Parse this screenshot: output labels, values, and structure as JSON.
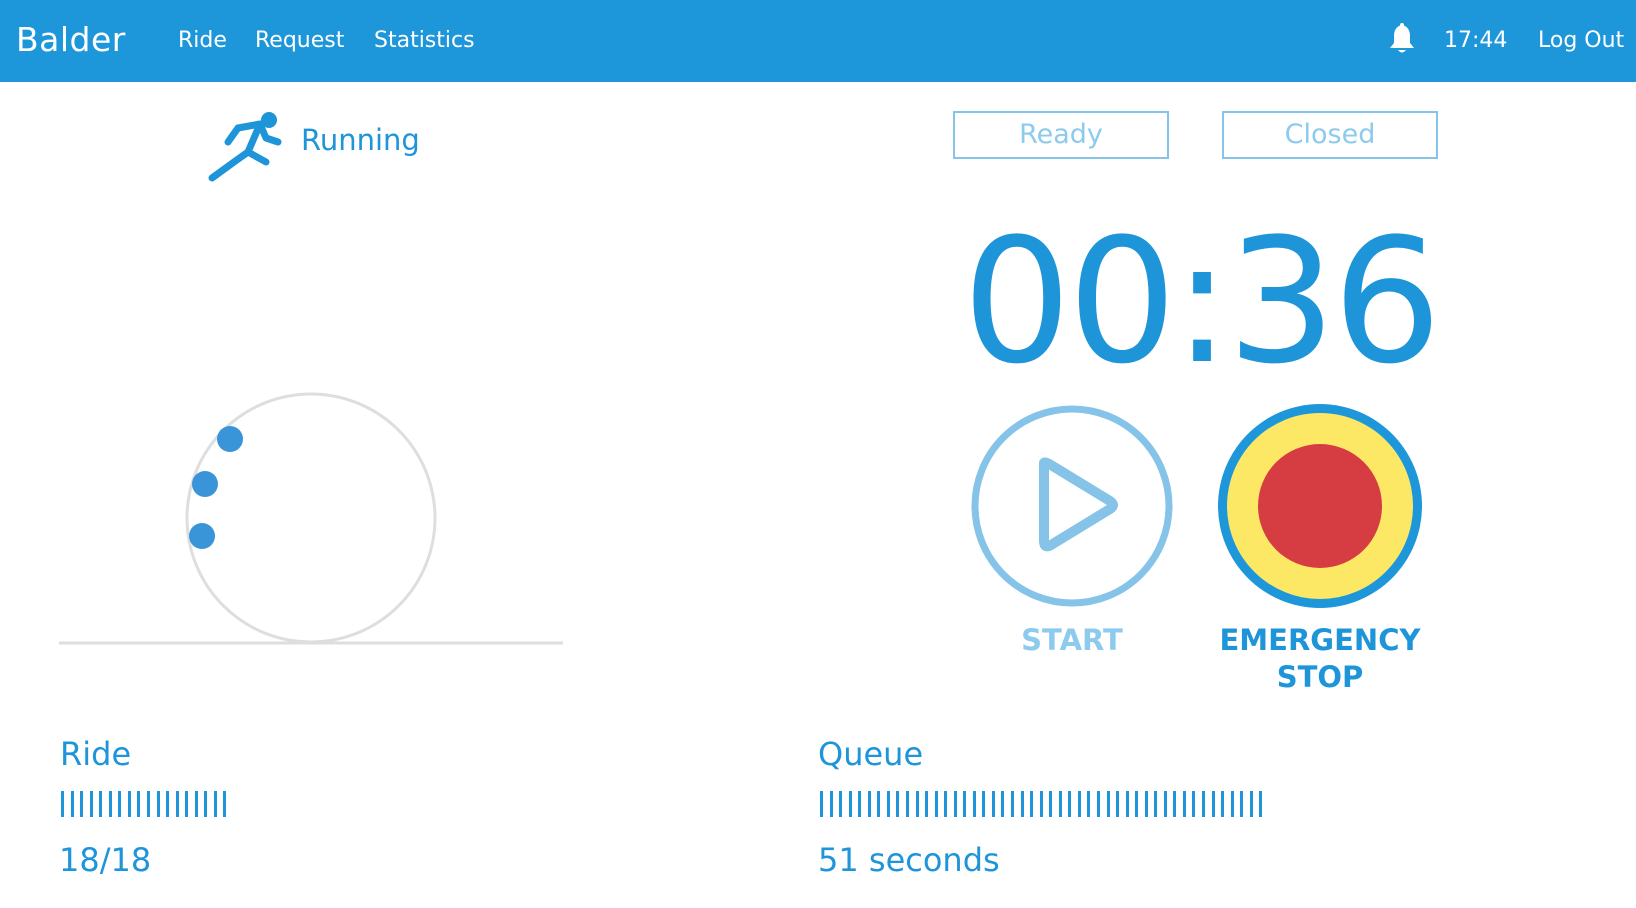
{
  "header": {
    "brand": "Balder",
    "nav": [
      "Ride",
      "Request",
      "Statistics"
    ],
    "time": "17:44",
    "logout": "Log Out",
    "icon": "bell-icon"
  },
  "status": {
    "label": "Running",
    "icon": "runner-icon"
  },
  "state_buttons": [
    "Ready",
    "Closed"
  ],
  "timer": "00:36",
  "controls": {
    "start_label": "START",
    "emergency_label_line1": "EMERGENCY",
    "emergency_label_line2": "STOP"
  },
  "ride": {
    "title": "Ride",
    "value": "18/18",
    "bar_count": 18
  },
  "queue": {
    "title": "Queue",
    "value": "51 seconds",
    "bar_count": 47
  },
  "colors": {
    "primary": "#1e96da",
    "light_blue": "#86c3e8",
    "emergency_red": "#d63d43",
    "emergency_yellow": "#fde866"
  }
}
